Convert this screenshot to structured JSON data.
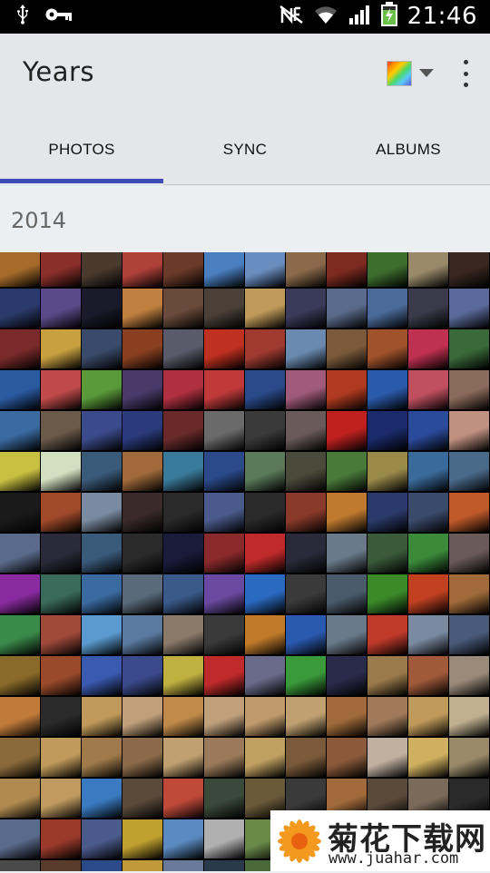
{
  "status_bar": {
    "time": "21:46",
    "left_icons": [
      "usb-icon",
      "key-icon"
    ],
    "right_icons": [
      "nfc-icon",
      "wifi-icon",
      "signal-icon",
      "battery-charging-icon"
    ]
  },
  "app_bar": {
    "title": "Years",
    "account_icon": "color-swatch-icon",
    "overflow_icon": "more-vert-icon"
  },
  "tabs": [
    {
      "label": "PHOTOS",
      "selected": true
    },
    {
      "label": "SYNC",
      "selected": false
    },
    {
      "label": "ALBUMS",
      "selected": false
    }
  ],
  "section": {
    "year": "2014"
  },
  "colors": {
    "tab_indicator": "#3d4cb6",
    "app_bar_bg": "#e4e6e9",
    "page_bg": "#eceff1"
  },
  "photo_grid": {
    "columns": 12,
    "visible_rows": 16,
    "thumbnail_colors": [
      "#a66b2a",
      "#8a2f2a",
      "#4a3a2e",
      "#b0413a",
      "#6b3a28",
      "#4a7fc0",
      "#6a8dbf",
      "#8a6a4a",
      "#7d2a20",
      "#3e6e2e",
      "#9a8a6a",
      "#3a2820",
      "#2a3a6a",
      "#5b4a8a",
      "#1a1a2a",
      "#c08040",
      "#6a4a3a",
      "#4a4038",
      "#c09a5a",
      "#3a3a5a",
      "#5a6a8a",
      "#4a6a9a",
      "#3a3a4a",
      "#5a6a9a",
      "#7a2a2a",
      "#c8a040",
      "#3a4a6a",
      "#8a4020",
      "#5a5a6a",
      "#c03020",
      "#a03a30",
      "#6a8ab0",
      "#7a5a3a",
      "#a0522a",
      "#c03050",
      "#3a6a3a",
      "#2a5aa0",
      "#c04a4a",
      "#5a9a3a",
      "#4a3a6a",
      "#b03040",
      "#c03a3a",
      "#2a4a8a",
      "#a05a7a",
      "#b03a20",
      "#2a5aaa",
      "#c05060",
      "#8a6a5a",
      "#3a6aa0",
      "#6a5a4a",
      "#3a4a8a",
      "#2a3a7a",
      "#6a2a2a",
      "#6a6a6a",
      "#3a3a3a",
      "#6a5a5a",
      "#c02020",
      "#1a2a6a",
      "#2a4a9a",
      "#c09080",
      "#c8c040",
      "#d0e0c0",
      "#3a5a7a",
      "#a06a3a",
      "#3a7a9a",
      "#2a4a8a",
      "#5a7a5a",
      "#4a4a3a",
      "#4a7a3a",
      "#9a8a4a",
      "#3a6a9a",
      "#4a6a8a",
      "#1a1a1a",
      "#a04a2a",
      "#7a8aa0",
      "#3a2a2a",
      "#2a2a2a",
      "#4a5a8a",
      "#2a2a2a",
      "#8a3a2a",
      "#c07a30",
      "#2a3a6a",
      "#3a4a6a",
      "#c05a2a",
      "#5a6a8a",
      "#2a2a3a",
      "#3a5a7a",
      "#2a2a2a",
      "#1a1a3a",
      "#8a2a2a",
      "#c02a2a",
      "#2a2a3a",
      "#6a7a8a",
      "#3a5a3a",
      "#3a8a3a",
      "#6a5a5a",
      "#8a2aa0",
      "#3a6a5a",
      "#3a6aa0",
      "#5a6a7a",
      "#3a5a8a",
      "#6a4aa0",
      "#2a6ac0",
      "#3a3a3a",
      "#4a5a6a",
      "#3a8a2a",
      "#c04020",
      "#a06a3a",
      "#3a8a4a",
      "#a04a3a",
      "#5a9ad0",
      "#5a7aa0",
      "#8a7a6a",
      "#3a3a3a",
      "#c07a2a",
      "#2a5ab0",
      "#6a7a8a",
      "#c03a2a",
      "#7a8aa0",
      "#4a5a7a",
      "#8a6a2a",
      "#9a4a2a",
      "#3a5ab0",
      "#3a4a8a",
      "#c0b040",
      "#c02a2a",
      "#6a6a8a",
      "#3a9a3a",
      "#2a2a4a",
      "#9a7a4a",
      "#a05a3a",
      "#9a8a7a",
      "#c07a3a",
      "#2a2a2a",
      "#c09a5a",
      "#c0a07a",
      "#c08a4a",
      "#c0a07a",
      "#c09a6a",
      "#c0a070",
      "#a06a3a",
      "#a07a5a",
      "#c09a5a",
      "#c0b090",
      "#8a6a3a",
      "#c09a5a",
      "#a07a4a",
      "#8a6a4a",
      "#c0a070",
      "#9a7a5a",
      "#c0a060",
      "#7a5a3a",
      "#8a5a3a",
      "#c0b0a0",
      "#d0b060",
      "#9a8a6a",
      "#b08a50",
      "#c09a60",
      "#3a7ac0",
      "#5a4a3a",
      "#c04a3a",
      "#3a4a3a",
      "#6a5a3a",
      "#3a3a3a",
      "#a06a3a",
      "#5a4a3a",
      "#7a6a5a",
      "#2a2a2a",
      "#5a6a8a",
      "#9a3a2a",
      "#4a5a8a",
      "#c0a030",
      "#5a8ac0",
      "#b0b0b0",
      "#6a8a4a",
      "#c04a3a",
      "#8a6a4a",
      "#3a5a3a",
      "#4a3a2a",
      "#3a3a3a",
      "#4a4a4a",
      "#5a3a2a",
      "#2a4a8a",
      "#c09a3a",
      "#6a7a9a",
      "#2a3a4a",
      "#4a6a3a",
      "#2a2a3a",
      "#3a3a2a",
      "#6a4a3a",
      "#3a3a4a",
      "#2a2a2a"
    ]
  },
  "watermark": {
    "cn_text": "菊花下载网",
    "url": "www.juahar.com"
  }
}
